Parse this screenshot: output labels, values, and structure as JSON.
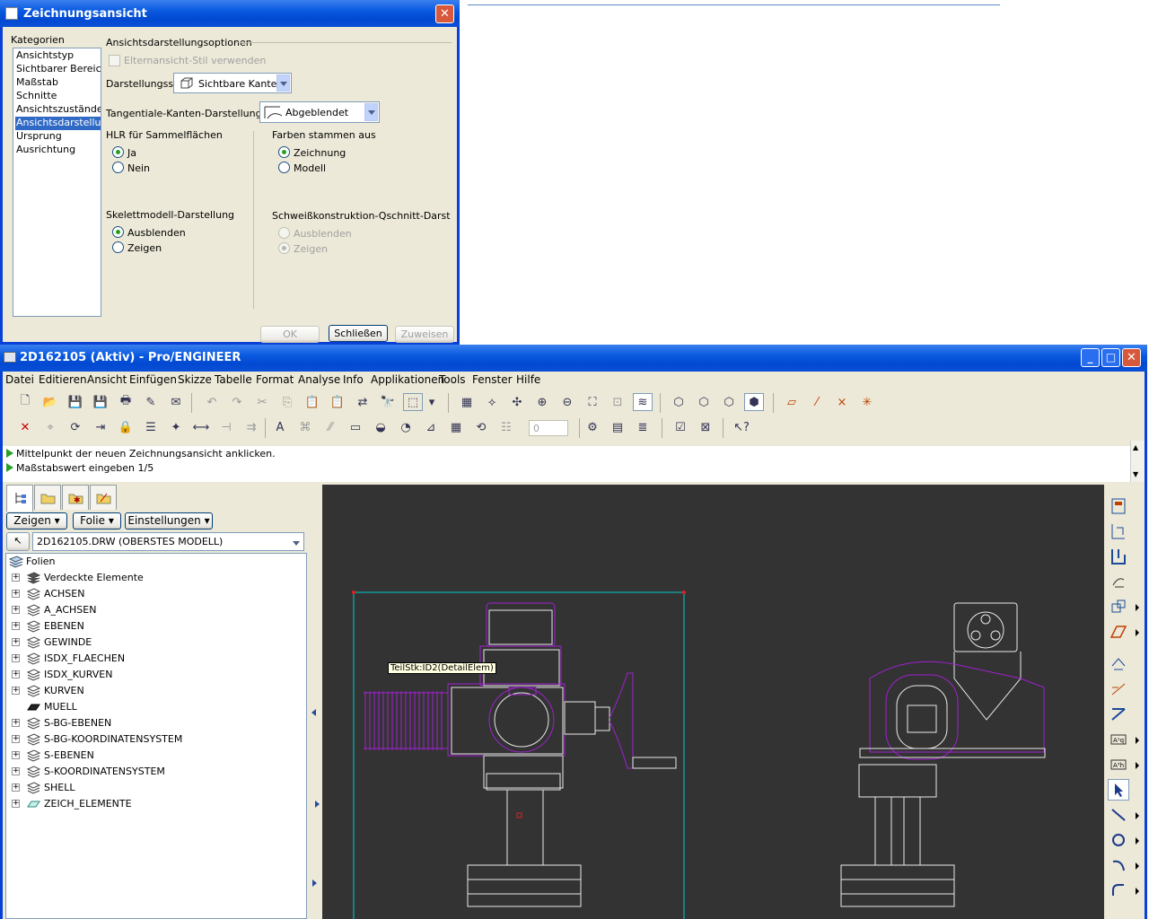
{
  "dialog": {
    "title": "Zeichnungsansicht",
    "categories_label": "Kategorien",
    "categories": [
      "Ansichtstyp",
      "Sichtbarer Bereich",
      "Maßstab",
      "Schnitte",
      "Ansichtszustände",
      "Ansichtsdarstellung",
      "Ursprung",
      "Ausrichtung"
    ],
    "selected_category": "Ansichtsdarstellung",
    "section_title": "Ansichtsdarstellungsoptionen",
    "parent_style_checkbox": "Elternansicht-Stil verwenden",
    "display_style_label": "Darstellungsstil",
    "display_style_value": "Sichtbare Kanten",
    "tangent_label": "Tangentiale-Kanten-Darstellungsstil",
    "tangent_value": "Abgeblendet",
    "hlr_title": "HLR für Sammelflächen",
    "hlr_yes": "Ja",
    "hlr_no": "Nein",
    "colors_title": "Farben stammen aus",
    "colors_drawing": "Zeichnung",
    "colors_model": "Modell",
    "skeleton_title": "Skelettmodell-Darstellung",
    "skeleton_hide": "Ausblenden",
    "skeleton_show": "Zeigen",
    "weld_title": "Schweißkonstruktion-Qschnitt-Darst",
    "weld_hide": "Ausblenden",
    "weld_show": "Zeigen",
    "ok_label": "OK",
    "close_label": "Schließen",
    "apply_label": "Zuweisen"
  },
  "main": {
    "title": "2D162105 (Aktiv) - Pro/ENGINEER",
    "menus": [
      "Datei",
      "Editieren",
      "Ansicht",
      "Einfügen",
      "Skizze",
      "Tabelle",
      "Format",
      "Analyse",
      "Info",
      "Applikationen",
      "Tools",
      "Fenster",
      "Hilfe"
    ],
    "messages": [
      "Mittelpunkt der neuen Zeichnungsansicht anklicken.",
      "Maßstabswert eingeben   1/5"
    ],
    "spin_value": "0",
    "tree_buttons": [
      "Zeigen",
      "Folie",
      "Einstellungen"
    ],
    "model_select": "2D162105.DRW (OBERSTES MODELL)",
    "tree_root": "Folien",
    "layers": [
      "Verdeckte Elemente",
      "ACHSEN",
      "A_ACHSEN",
      "EBENEN",
      "GEWINDE",
      "ISDX_FLAECHEN",
      "ISDX_KURVEN",
      "KURVEN",
      "MUELL",
      "S-BG-EBENEN",
      "S-BG-KOORDINATENSYSTEM",
      "S-EBENEN",
      "S-KOORDINATENSYSTEM",
      "SHELL",
      "ZEICH_ELEMENTE"
    ],
    "tooltip": "TeilStk:ID2(DetailElem)"
  },
  "colors": {
    "titlebar": "#0a5ae0",
    "graphics_bg": "#333333",
    "sheet_border": "#00c8c8",
    "model_primary": "#a020d0",
    "model_edges": "#e8e8e8"
  }
}
